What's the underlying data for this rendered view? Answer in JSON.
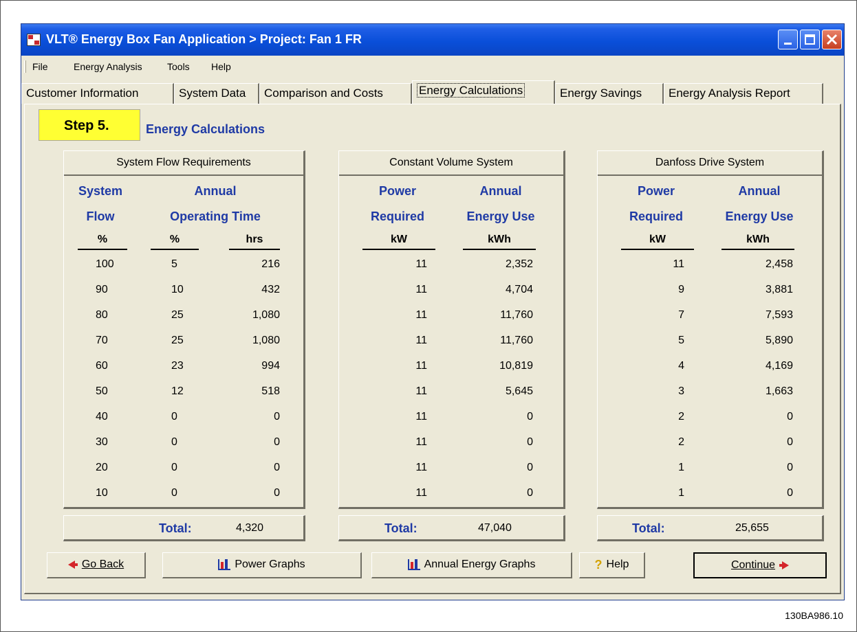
{
  "window": {
    "title": "VLT® Energy Box Fan Application > Project: Fan 1 FR"
  },
  "menu": {
    "file": "File",
    "energy_analysis": "Energy Analysis",
    "tools": "Tools",
    "help": "Help"
  },
  "tabs": [
    {
      "label": "Customer Information"
    },
    {
      "label": "System Data"
    },
    {
      "label": "Comparison and Costs"
    },
    {
      "label": "Energy Calculations",
      "active": true
    },
    {
      "label": "Energy Savings"
    },
    {
      "label": "Energy Analysis Report"
    }
  ],
  "step": {
    "badge": "Step 5.",
    "title": "Energy Calculations"
  },
  "groups": {
    "flow": {
      "header": "System Flow Requirements",
      "col1": {
        "line1": "System",
        "line2": "Flow",
        "unit": "%"
      },
      "col23": {
        "line1": "Annual",
        "line2": "Operating Time"
      },
      "unit2": "%",
      "unit3": "hrs",
      "rows": [
        [
          "100",
          "5",
          "216"
        ],
        [
          "90",
          "10",
          "432"
        ],
        [
          "80",
          "25",
          "1,080"
        ],
        [
          "70",
          "25",
          "1,080"
        ],
        [
          "60",
          "23",
          "994"
        ],
        [
          "50",
          "12",
          "518"
        ],
        [
          "40",
          "0",
          "0"
        ],
        [
          "30",
          "0",
          "0"
        ],
        [
          "20",
          "0",
          "0"
        ],
        [
          "10",
          "0",
          "0"
        ]
      ],
      "total_label": "Total:",
      "total_value": "4,320"
    },
    "constant": {
      "header": "Constant Volume System",
      "col1": {
        "line1": "Power",
        "line2": "Required",
        "unit": "kW"
      },
      "col2": {
        "line1": "Annual",
        "line2": "Energy Use",
        "unit": "kWh"
      },
      "rows": [
        [
          "11",
          "2,352"
        ],
        [
          "11",
          "4,704"
        ],
        [
          "11",
          "11,760"
        ],
        [
          "11",
          "11,760"
        ],
        [
          "11",
          "10,819"
        ],
        [
          "11",
          "5,645"
        ],
        [
          "11",
          "0"
        ],
        [
          "11",
          "0"
        ],
        [
          "11",
          "0"
        ],
        [
          "11",
          "0"
        ]
      ],
      "total_label": "Total:",
      "total_value": "47,040"
    },
    "danfoss": {
      "header": "Danfoss Drive System",
      "col1": {
        "line1": "Power",
        "line2": "Required",
        "unit": "kW"
      },
      "col2": {
        "line1": "Annual",
        "line2": "Energy Use",
        "unit": "kWh"
      },
      "rows": [
        [
          "11",
          "2,458"
        ],
        [
          "9",
          "3,881"
        ],
        [
          "7",
          "7,593"
        ],
        [
          "5",
          "5,890"
        ],
        [
          "4",
          "4,169"
        ],
        [
          "3",
          "1,663"
        ],
        [
          "2",
          "0"
        ],
        [
          "2",
          "0"
        ],
        [
          "1",
          "0"
        ],
        [
          "1",
          "0"
        ]
      ],
      "total_label": "Total:",
      "total_value": "25,655"
    }
  },
  "buttons": {
    "go_back": "Go Back",
    "power_graphs": "Power Graphs",
    "annual_energy_graphs": "Annual Energy Graphs",
    "help": "Help",
    "continue": "Continue"
  },
  "icons": {
    "app": "app-icon",
    "go_back": "arrow-left-icon",
    "continue": "arrow-right-icon",
    "graphs": "bar-chart-icon",
    "help": "question-mark-icon"
  },
  "colors": {
    "title_bar": "#0a4fd9",
    "step_badge": "#ffff33",
    "heading_blue": "#1f3aa5",
    "arrow_red": "#d4252a"
  },
  "figure_id": "130BA986.10"
}
